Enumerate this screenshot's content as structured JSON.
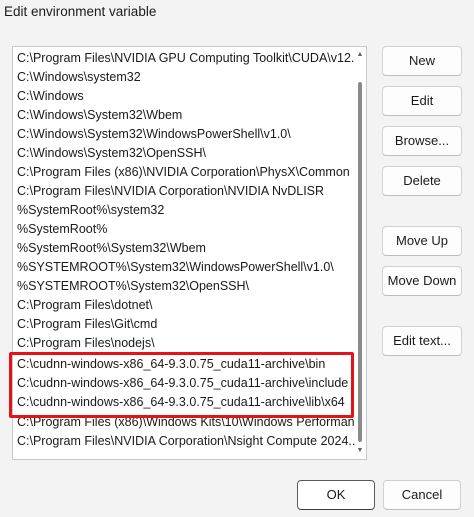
{
  "window": {
    "title": "Edit environment variable"
  },
  "path_list": {
    "items": [
      "C:\\Program Files\\NVIDIA GPU Computing Toolkit\\CUDA\\v12....",
      "C:\\Windows\\system32",
      "C:\\Windows",
      "C:\\Windows\\System32\\Wbem",
      "C:\\Windows\\System32\\WindowsPowerShell\\v1.0\\",
      "C:\\Windows\\System32\\OpenSSH\\",
      "C:\\Program Files (x86)\\NVIDIA Corporation\\PhysX\\Common",
      "C:\\Program Files\\NVIDIA Corporation\\NVIDIA NvDLISR",
      "%SystemRoot%\\system32",
      "%SystemRoot%",
      "%SystemRoot%\\System32\\Wbem",
      "%SYSTEMROOT%\\System32\\WindowsPowerShell\\v1.0\\",
      "%SYSTEMROOT%\\System32\\OpenSSH\\",
      "C:\\Program Files\\dotnet\\",
      "C:\\Program Files\\Git\\cmd",
      "C:\\Program Files\\nodejs\\",
      "C:\\cudnn-windows-x86_64-9.3.0.75_cuda11-archive\\bin",
      "C:\\cudnn-windows-x86_64-9.3.0.75_cuda11-archive\\include",
      "C:\\cudnn-windows-x86_64-9.3.0.75_cuda11-archive\\lib\\x64",
      "C:\\Program Files (x86)\\Windows Kits\\10\\Windows Performan...",
      "C:\\Program Files\\NVIDIA Corporation\\Nsight Compute 2024...."
    ],
    "highlight_color": "#e5121a"
  },
  "buttons": {
    "new": "New",
    "edit": "Edit",
    "browse": "Browse...",
    "delete": "Delete",
    "move_up": "Move Up",
    "move_down": "Move Down",
    "edit_text": "Edit text...",
    "ok": "OK",
    "cancel": "Cancel"
  },
  "scrollbar": {
    "up_icon": "chevron-up-icon",
    "down_icon": "chevron-down-icon"
  }
}
